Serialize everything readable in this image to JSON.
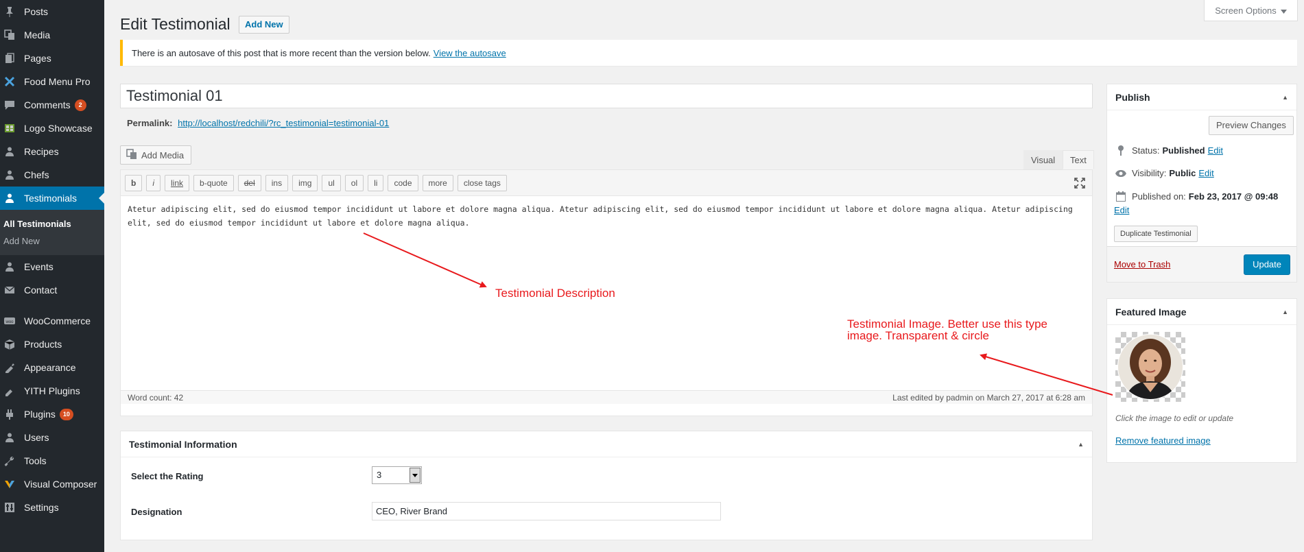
{
  "sidebar": {
    "items_top": [
      {
        "label": "Posts",
        "icon": "pushpin-icon"
      },
      {
        "label": "Media",
        "icon": "media-icon"
      },
      {
        "label": "Pages",
        "icon": "pages-icon"
      },
      {
        "label": "Food Menu Pro",
        "icon": "food-icon"
      },
      {
        "label": "Comments",
        "icon": "comments-icon",
        "badge": "2"
      },
      {
        "label": "Logo Showcase",
        "icon": "logo-icon"
      },
      {
        "label": "Recipes",
        "icon": "recipes-icon"
      },
      {
        "label": "Chefs",
        "icon": "chefs-icon"
      }
    ],
    "current": {
      "label": "Testimonials",
      "icon": "testimonials-icon"
    },
    "submenu": [
      "All Testimonials",
      "Add New"
    ],
    "items_mid": [
      {
        "label": "Events",
        "icon": "events-icon"
      },
      {
        "label": "Contact",
        "icon": "contact-icon"
      }
    ],
    "items_bottom": [
      {
        "label": "WooCommerce",
        "icon": "woocommerce-icon"
      },
      {
        "label": "Products",
        "icon": "products-icon"
      },
      {
        "label": "Appearance",
        "icon": "appearance-icon"
      },
      {
        "label": "YITH Plugins",
        "icon": "yith-icon"
      },
      {
        "label": "Plugins",
        "icon": "plugins-icon",
        "badge": "10"
      },
      {
        "label": "Users",
        "icon": "users-icon"
      },
      {
        "label": "Tools",
        "icon": "tools-icon"
      },
      {
        "label": "Visual Composer",
        "icon": "visual-composer-icon"
      },
      {
        "label": "Settings",
        "icon": "settings-icon"
      }
    ]
  },
  "header": {
    "title": "Edit Testimonial",
    "add_new": "Add New",
    "screen_options": "Screen Options"
  },
  "notice": {
    "text": "There is an autosave of this post that is more recent than the version below.",
    "link": "View the autosave"
  },
  "post": {
    "title": "Testimonial 01",
    "permalink_label": "Permalink:",
    "permalink_url": "http://localhost/redchili/?rc_testimonial=testimonial-01"
  },
  "editor": {
    "add_media": "Add Media",
    "tab_visual": "Visual",
    "tab_text": "Text",
    "quicktags": [
      "b",
      "i",
      "link",
      "b-quote",
      "del",
      "ins",
      "img",
      "ul",
      "ol",
      "li",
      "code",
      "more",
      "close tags"
    ],
    "content": "Atetur adipiscing elit, sed do eiusmod tempor incididunt ut labore et dolore magna aliqua. Atetur adipiscing elit, sed do eiusmod tempor incididunt ut labore et dolore magna aliqua. Atetur adipiscing elit, sed do eiusmod tempor incididunt ut labore et dolore magna aliqua.",
    "word_count": "Word count: 42",
    "last_edited": "Last edited by padmin on March 27, 2017 at 6:28 am"
  },
  "annotations": {
    "description": "Testimonial Description",
    "image": "Testimonial Image. Better use this type image. Transparent & circle",
    "color": "#e8191c"
  },
  "testimonial_info": {
    "title": "Testimonial Information",
    "rating_label": "Select the Rating",
    "rating_value": "3",
    "designation_label": "Designation",
    "designation_value": "CEO, River Brand"
  },
  "publish": {
    "title": "Publish",
    "preview": "Preview Changes",
    "status_label": "Status:",
    "status_value": "Published",
    "visibility_label": "Visibility:",
    "visibility_value": "Public",
    "published_label": "Published on:",
    "published_value": "Feb 23, 2017 @ 09:48",
    "edit": "Edit",
    "duplicate": "Duplicate Testimonial",
    "trash": "Move to Trash",
    "update": "Update"
  },
  "featured_image": {
    "title": "Featured Image",
    "hint": "Click the image to edit or update",
    "remove": "Remove featured image"
  },
  "colors": {
    "sidebar_bg": "#23282d",
    "accent": "#0073aa",
    "primary_button": "#0085ba",
    "badge": "#d54e21",
    "notice_border": "#ffb900"
  }
}
